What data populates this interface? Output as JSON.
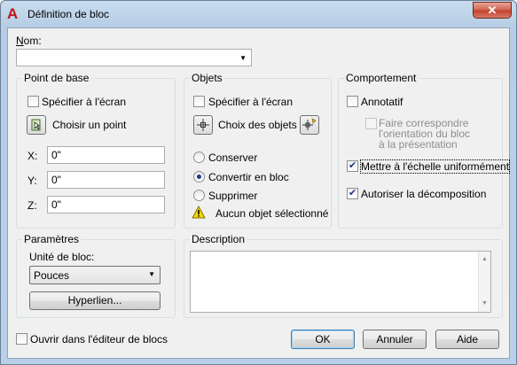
{
  "window": {
    "title": "Définition de bloc",
    "close_glyph": "✕",
    "app_icon": "A"
  },
  "name": {
    "label": "Nom:",
    "value": ""
  },
  "base_point": {
    "title": "Point de base",
    "specify_onscreen": "Spécifier à l'écran",
    "specify_checked": false,
    "pick_point": "Choisir un point",
    "x_label": "X:",
    "x_value": "0\"",
    "y_label": "Y:",
    "y_value": "0\"",
    "z_label": "Z:",
    "z_value": "0\""
  },
  "objects": {
    "title": "Objets",
    "specify_onscreen": "Spécifier à l'écran",
    "specify_checked": false,
    "select_objects": "Choix des objets",
    "retain": "Conserver",
    "convert": "Convertir en bloc",
    "delete": "Supprimer",
    "selected_option": "convert",
    "status": "Aucun objet sélectionné"
  },
  "behavior": {
    "title": "Comportement",
    "annotative": "Annotatif",
    "annotative_checked": false,
    "match_orientation": [
      "Faire correspondre",
      "l'orientation du bloc",
      "à la présentation"
    ],
    "match_checked": false,
    "scale_uniformly": "Mettre à l'échelle uniformément",
    "scale_checked": true,
    "allow_explode": "Autoriser la décomposition",
    "explode_checked": true
  },
  "settings": {
    "title": "Paramètres",
    "unit_label": "Unité de bloc:",
    "unit_value": "Pouces",
    "hyperlink": "Hyperlien..."
  },
  "description": {
    "title": "Description",
    "value": ""
  },
  "footer": {
    "open_editor": "Ouvrir dans l'éditeur de blocs",
    "open_editor_checked": false,
    "ok": "OK",
    "cancel": "Annuler",
    "help": "Aide"
  },
  "colors": {
    "accent": "#c0141a",
    "title_gradient_top": "#c9dcef",
    "warning": "#f5d800"
  }
}
